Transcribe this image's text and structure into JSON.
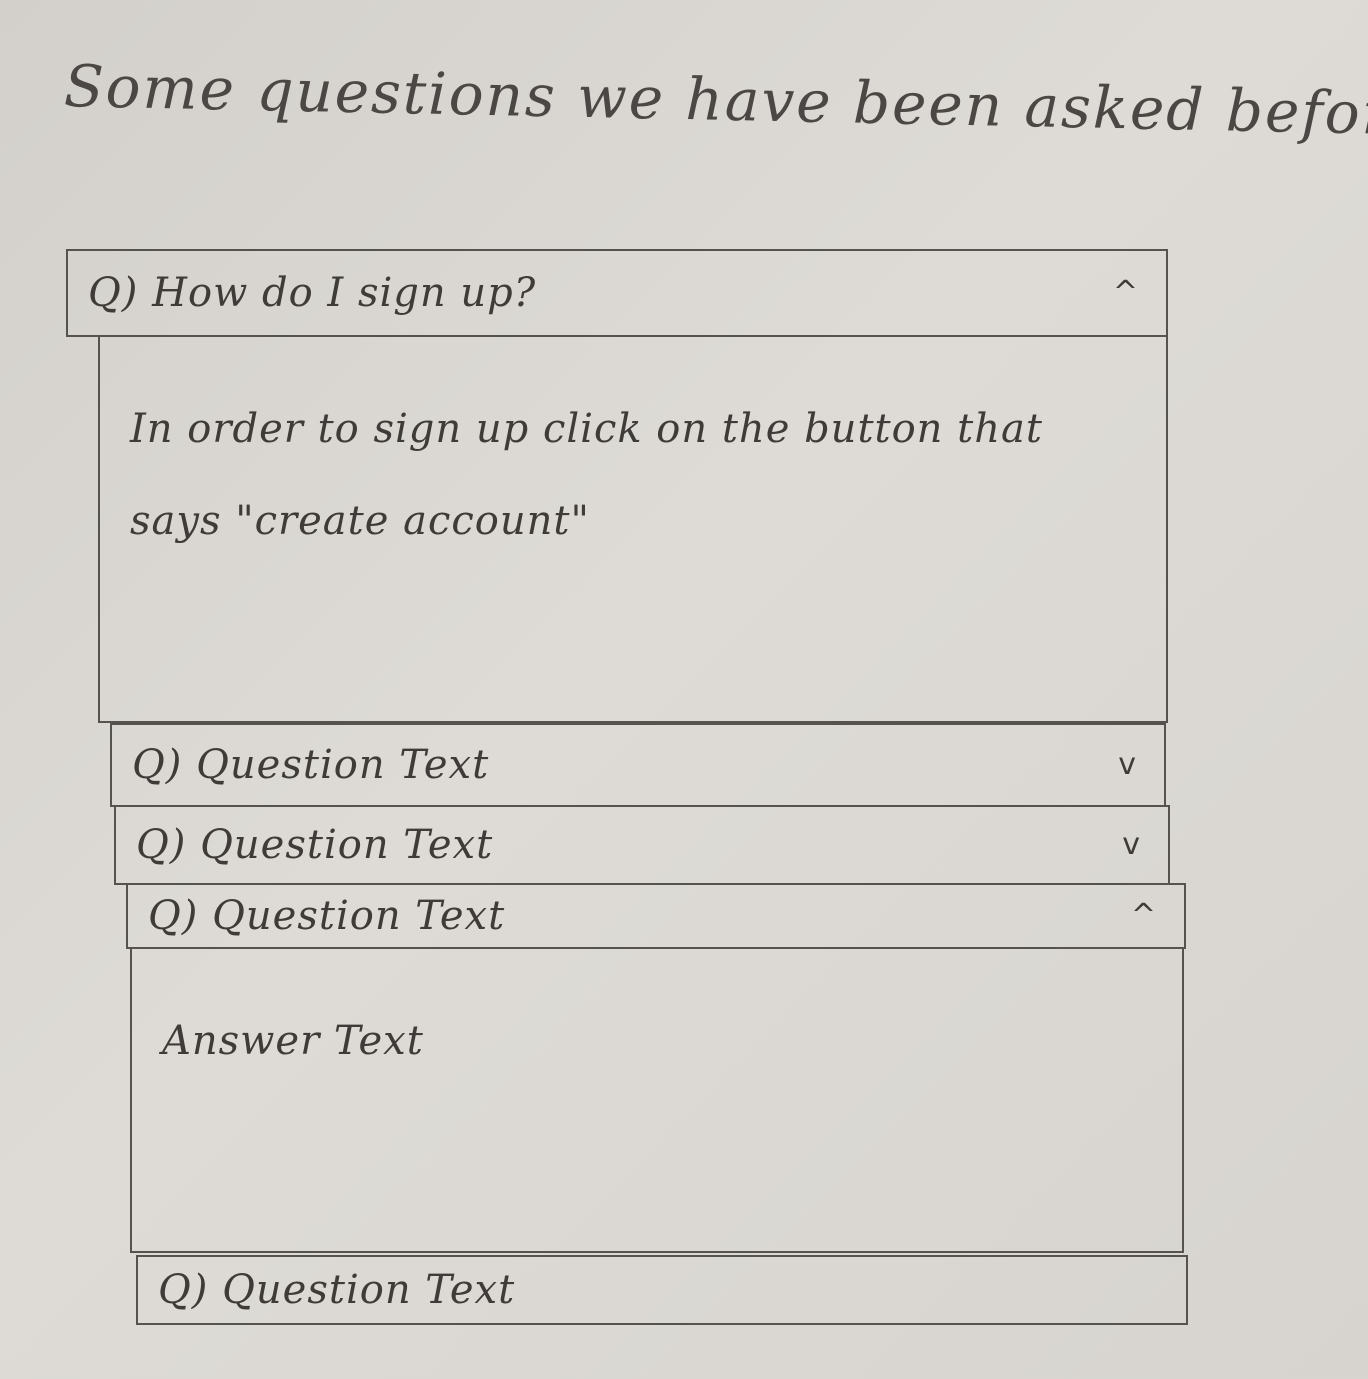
{
  "page_title": "Some questions we have been asked before",
  "faq": {
    "items": [
      {
        "question": "Q) How do I sign up?",
        "chevron": "^",
        "chevron_icon": "chevron-up-icon",
        "expanded": true,
        "answer": "In order to sign up click on the button that says \"create account\""
      },
      {
        "question": "Q) Question Text",
        "chevron": "v",
        "chevron_icon": "chevron-down-icon",
        "expanded": false
      },
      {
        "question": "Q) Question Text",
        "chevron": "v",
        "chevron_icon": "chevron-down-icon",
        "expanded": false
      },
      {
        "question": "Q) Question Text",
        "chevron": "^",
        "chevron_icon": "chevron-up-icon",
        "expanded": true,
        "answer": "Answer Text"
      },
      {
        "question": "Q) Question Text",
        "chevron": "",
        "expanded": false
      }
    ]
  }
}
